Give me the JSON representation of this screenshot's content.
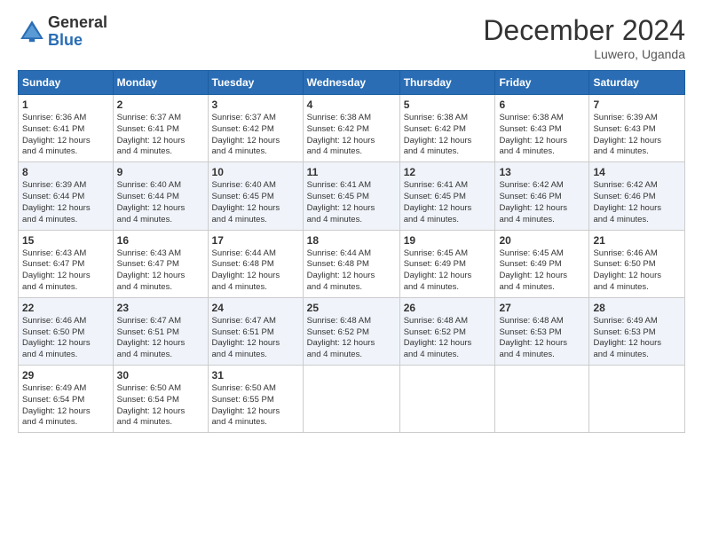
{
  "logo": {
    "general": "General",
    "blue": "Blue"
  },
  "title": "December 2024",
  "location": "Luwero, Uganda",
  "days_of_week": [
    "Sunday",
    "Monday",
    "Tuesday",
    "Wednesday",
    "Thursday",
    "Friday",
    "Saturday"
  ],
  "weeks": [
    [
      {
        "day": 1,
        "sunrise": "6:36 AM",
        "sunset": "6:41 PM",
        "daylight": "12 hours and 4 minutes."
      },
      {
        "day": 2,
        "sunrise": "6:37 AM",
        "sunset": "6:41 PM",
        "daylight": "12 hours and 4 minutes."
      },
      {
        "day": 3,
        "sunrise": "6:37 AM",
        "sunset": "6:42 PM",
        "daylight": "12 hours and 4 minutes."
      },
      {
        "day": 4,
        "sunrise": "6:38 AM",
        "sunset": "6:42 PM",
        "daylight": "12 hours and 4 minutes."
      },
      {
        "day": 5,
        "sunrise": "6:38 AM",
        "sunset": "6:42 PM",
        "daylight": "12 hours and 4 minutes."
      },
      {
        "day": 6,
        "sunrise": "6:38 AM",
        "sunset": "6:43 PM",
        "daylight": "12 hours and 4 minutes."
      },
      {
        "day": 7,
        "sunrise": "6:39 AM",
        "sunset": "6:43 PM",
        "daylight": "12 hours and 4 minutes."
      }
    ],
    [
      {
        "day": 8,
        "sunrise": "6:39 AM",
        "sunset": "6:44 PM",
        "daylight": "12 hours and 4 minutes."
      },
      {
        "day": 9,
        "sunrise": "6:40 AM",
        "sunset": "6:44 PM",
        "daylight": "12 hours and 4 minutes."
      },
      {
        "day": 10,
        "sunrise": "6:40 AM",
        "sunset": "6:45 PM",
        "daylight": "12 hours and 4 minutes."
      },
      {
        "day": 11,
        "sunrise": "6:41 AM",
        "sunset": "6:45 PM",
        "daylight": "12 hours and 4 minutes."
      },
      {
        "day": 12,
        "sunrise": "6:41 AM",
        "sunset": "6:45 PM",
        "daylight": "12 hours and 4 minutes."
      },
      {
        "day": 13,
        "sunrise": "6:42 AM",
        "sunset": "6:46 PM",
        "daylight": "12 hours and 4 minutes."
      },
      {
        "day": 14,
        "sunrise": "6:42 AM",
        "sunset": "6:46 PM",
        "daylight": "12 hours and 4 minutes."
      }
    ],
    [
      {
        "day": 15,
        "sunrise": "6:43 AM",
        "sunset": "6:47 PM",
        "daylight": "12 hours and 4 minutes."
      },
      {
        "day": 16,
        "sunrise": "6:43 AM",
        "sunset": "6:47 PM",
        "daylight": "12 hours and 4 minutes."
      },
      {
        "day": 17,
        "sunrise": "6:44 AM",
        "sunset": "6:48 PM",
        "daylight": "12 hours and 4 minutes."
      },
      {
        "day": 18,
        "sunrise": "6:44 AM",
        "sunset": "6:48 PM",
        "daylight": "12 hours and 4 minutes."
      },
      {
        "day": 19,
        "sunrise": "6:45 AM",
        "sunset": "6:49 PM",
        "daylight": "12 hours and 4 minutes."
      },
      {
        "day": 20,
        "sunrise": "6:45 AM",
        "sunset": "6:49 PM",
        "daylight": "12 hours and 4 minutes."
      },
      {
        "day": 21,
        "sunrise": "6:46 AM",
        "sunset": "6:50 PM",
        "daylight": "12 hours and 4 minutes."
      }
    ],
    [
      {
        "day": 22,
        "sunrise": "6:46 AM",
        "sunset": "6:50 PM",
        "daylight": "12 hours and 4 minutes."
      },
      {
        "day": 23,
        "sunrise": "6:47 AM",
        "sunset": "6:51 PM",
        "daylight": "12 hours and 4 minutes."
      },
      {
        "day": 24,
        "sunrise": "6:47 AM",
        "sunset": "6:51 PM",
        "daylight": "12 hours and 4 minutes."
      },
      {
        "day": 25,
        "sunrise": "6:48 AM",
        "sunset": "6:52 PM",
        "daylight": "12 hours and 4 minutes."
      },
      {
        "day": 26,
        "sunrise": "6:48 AM",
        "sunset": "6:52 PM",
        "daylight": "12 hours and 4 minutes."
      },
      {
        "day": 27,
        "sunrise": "6:48 AM",
        "sunset": "6:53 PM",
        "daylight": "12 hours and 4 minutes."
      },
      {
        "day": 28,
        "sunrise": "6:49 AM",
        "sunset": "6:53 PM",
        "daylight": "12 hours and 4 minutes."
      }
    ],
    [
      {
        "day": 29,
        "sunrise": "6:49 AM",
        "sunset": "6:54 PM",
        "daylight": "12 hours and 4 minutes."
      },
      {
        "day": 30,
        "sunrise": "6:50 AM",
        "sunset": "6:54 PM",
        "daylight": "12 hours and 4 minutes."
      },
      {
        "day": 31,
        "sunrise": "6:50 AM",
        "sunset": "6:55 PM",
        "daylight": "12 hours and 4 minutes."
      },
      null,
      null,
      null,
      null
    ]
  ]
}
